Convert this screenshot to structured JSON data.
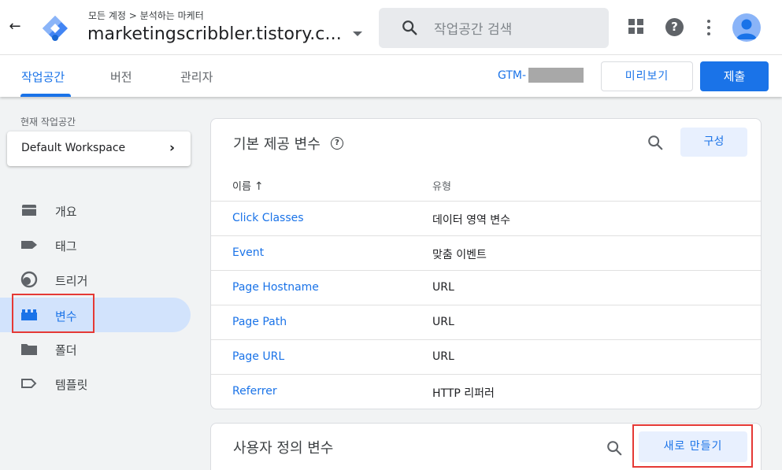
{
  "header": {
    "breadcrumb": "모든 계정 > 분석하는 마케터",
    "container_name": "marketingscribbler.tistory.c...",
    "search_placeholder": "작업공간 검색"
  },
  "subnav": {
    "tabs": [
      {
        "label": "작업공간",
        "active": true
      },
      {
        "label": "버전",
        "active": false
      },
      {
        "label": "관리자",
        "active": false
      }
    ],
    "gtm_id_prefix": "GTM-",
    "preview_label": "미리보기",
    "submit_label": "제출"
  },
  "sidebar": {
    "workspace_label": "현재 작업공간",
    "workspace_name": "Default Workspace",
    "items": [
      {
        "label": "개요",
        "icon": "overview-icon",
        "active": false
      },
      {
        "label": "태그",
        "icon": "tag-icon",
        "active": false
      },
      {
        "label": "트리거",
        "icon": "trigger-icon",
        "active": false
      },
      {
        "label": "변수",
        "icon": "variables-icon",
        "active": true
      },
      {
        "label": "폴더",
        "icon": "folder-icon",
        "active": false
      },
      {
        "label": "템플릿",
        "icon": "template-icon",
        "active": false
      }
    ]
  },
  "builtin_vars": {
    "title": "기본 제공 변수",
    "configure_label": "구성",
    "columns": {
      "name": "이름",
      "type": "유형"
    },
    "rows": [
      {
        "name": "Click Classes",
        "type": "데이터 영역 변수"
      },
      {
        "name": "Event",
        "type": "맞춤 이벤트"
      },
      {
        "name": "Page Hostname",
        "type": "URL"
      },
      {
        "name": "Page Path",
        "type": "URL"
      },
      {
        "name": "Page URL",
        "type": "URL"
      },
      {
        "name": "Referrer",
        "type": "HTTP 리퍼러"
      }
    ]
  },
  "user_vars": {
    "title": "사용자 정의 변수",
    "new_label": "새로 만들기"
  },
  "colors": {
    "accent": "#1a73e8",
    "highlight_box": "#e53935",
    "active_nav_bg": "#d2e3fc"
  }
}
